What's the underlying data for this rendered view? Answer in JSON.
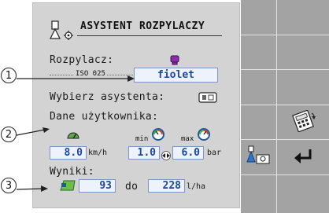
{
  "title": "ASYSTENT ROZPYLACZY",
  "nozzle": {
    "label": "Rozpylacz:",
    "standard": "ISO 025",
    "value": "fiolet",
    "color": "#8b2fa8"
  },
  "assistant": {
    "label": "Wybierz asystenta:"
  },
  "user_data": {
    "label": "Dane użytkownika:",
    "speed": {
      "value": "8.0",
      "unit": "km/h"
    },
    "pressure_min": {
      "label": "min",
      "value": "1.0"
    },
    "pressure_max": {
      "label": "max",
      "value": "6.0",
      "unit": "bar"
    }
  },
  "results": {
    "label": "Wyniki:",
    "from": "93",
    "to_label": "do",
    "to": "228",
    "unit": "l/ha"
  },
  "callouts": [
    "1",
    "2",
    "3"
  ],
  "icons": {
    "header": "nozzle-settings-icon",
    "assistant": "assistant-select-icon",
    "speed": "speedometer-icon",
    "pressure_min": "pressure-gauge-icon",
    "pressure_max": "pressure-gauge-icon",
    "swap": "swap-arrows-icon",
    "results": "field-rate-icon",
    "softkey_calc": "calculator-icon",
    "softkey_nozzle": "nozzle-settings-icon",
    "softkey_back": "back-arrow-icon"
  },
  "colors": {
    "panel": "#d3d3d3",
    "softkey_bar": "#a3a3a3",
    "field_text": "#1d47a3",
    "field_border": "#7b95c8"
  }
}
